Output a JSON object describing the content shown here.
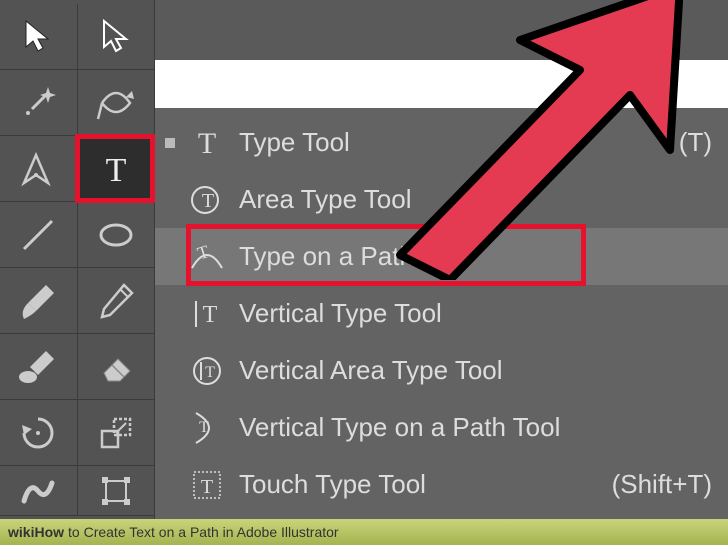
{
  "flyout": {
    "items": [
      {
        "label": "Type Tool",
        "shortcut": "(T)"
      },
      {
        "label": "Area Type Tool",
        "shortcut": ""
      },
      {
        "label": "Type on a Path Tool",
        "shortcut": ""
      },
      {
        "label": "Vertical Type Tool",
        "shortcut": ""
      },
      {
        "label": "Vertical Area Type Tool",
        "shortcut": ""
      },
      {
        "label": "Vertical Type on a Path Tool",
        "shortcut": ""
      },
      {
        "label": "Touch Type Tool",
        "shortcut": "(Shift+T)"
      }
    ]
  },
  "caption": {
    "brand": "wikiHow",
    "text": " to Create Text on a Path in Adobe Illustrator"
  }
}
